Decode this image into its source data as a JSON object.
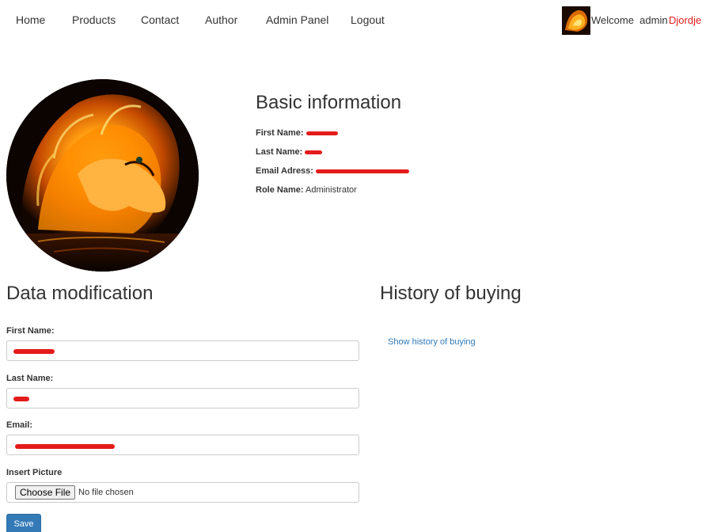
{
  "nav": {
    "links": [
      "Home",
      "Products",
      "Contact",
      "Author",
      "Admin Panel",
      "Logout"
    ],
    "welcome": "Welcome  admin",
    "username": "Djordje"
  },
  "basic": {
    "title": "Basic information",
    "first_name_label": "First Name:",
    "last_name_label": "Last Name:",
    "email_label": "Email Adress:",
    "role_label": "Role Name:",
    "role_value": "Administrator"
  },
  "form": {
    "title": "Data modification",
    "first_name_label": "First Name:",
    "last_name_label": "Last Name:",
    "email_label": "Email:",
    "picture_label": "Insert Picture",
    "choose_file": "Choose File",
    "no_file": "No file chosen",
    "save": "Save"
  },
  "history": {
    "title": "History of buying",
    "link": "Show history of buying"
  },
  "colors": {
    "accent": "#337ab7",
    "redaction": "#e41b1b",
    "username": "#e41b1b"
  }
}
